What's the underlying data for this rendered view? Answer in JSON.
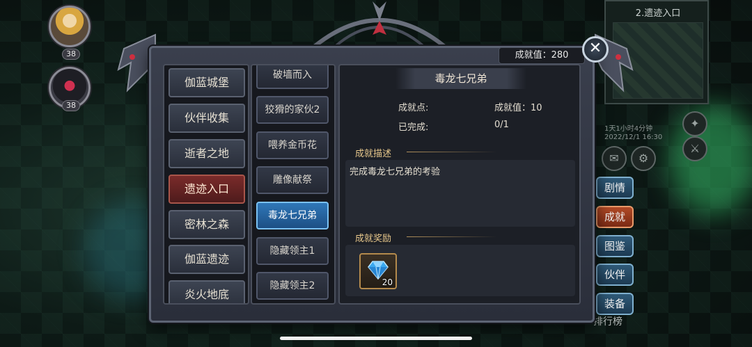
{
  "avatars": [
    {
      "level": "38"
    },
    {
      "level": "38"
    }
  ],
  "right_panel": {
    "title": "2.遗迹入口",
    "sub_time": "1天1小时4分钟",
    "sub_date": "2022/12/1 16:30"
  },
  "side_menu": [
    {
      "label": "剧情",
      "active": false
    },
    {
      "label": "成就",
      "active": true
    },
    {
      "label": "图鉴",
      "active": false
    },
    {
      "label": "伙伴",
      "active": false
    },
    {
      "label": "装备",
      "active": false
    }
  ],
  "rank_label": "排行榜",
  "dialog": {
    "score_text": "成就值：280",
    "close_symbol": "✕",
    "categories": [
      {
        "label": "伽蓝城堡",
        "active": false
      },
      {
        "label": "伙伴收集",
        "active": false
      },
      {
        "label": "逝者之地",
        "active": false
      },
      {
        "label": "遗迹入口",
        "active": true
      },
      {
        "label": "密林之森",
        "active": false
      },
      {
        "label": "伽蓝遗迹",
        "active": false
      },
      {
        "label": "炎火地底",
        "active": false
      }
    ],
    "achievements": [
      {
        "label": "破墙而入",
        "active": false
      },
      {
        "label": "狡猾的家伙2",
        "active": false
      },
      {
        "label": "喂养金币花",
        "active": false
      },
      {
        "label": "雕像献祭",
        "active": false
      },
      {
        "label": "毒龙七兄弟",
        "active": true
      },
      {
        "label": "隐藏领主1",
        "active": false
      },
      {
        "label": "隐藏领主2",
        "active": false
      }
    ],
    "detail": {
      "title": "毒龙七兄弟",
      "points_label": "成就点:",
      "value_text": "成就值：10",
      "completed_label": "已完成:",
      "progress_text": "0/1",
      "desc_label": "成就描述",
      "desc_text": "完成毒龙七兄弟的考验",
      "reward_label": "成就奖励",
      "reward": {
        "icon": "diamond-icon",
        "count": "20"
      }
    }
  },
  "colors": {
    "active_category": "#7a2b2a",
    "active_achievement": "#2f77b8",
    "section_label": "#e8c88c"
  }
}
